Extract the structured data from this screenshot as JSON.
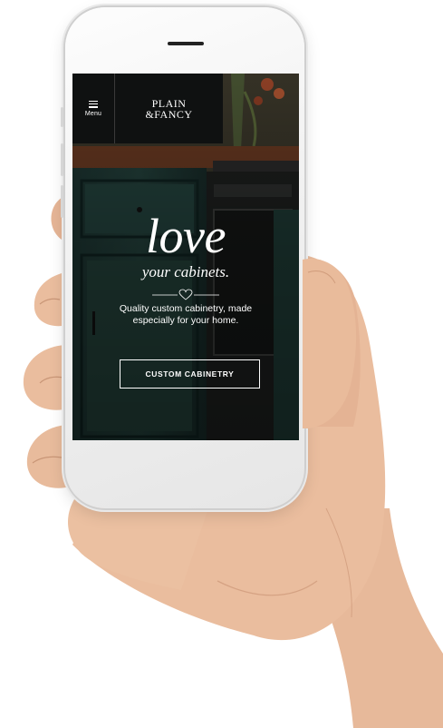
{
  "header": {
    "menu_label": "Menu",
    "logo_line1": "PLAIN",
    "logo_line2": "&FANCY"
  },
  "hero": {
    "title": "love",
    "subtitle": "your cabinets.",
    "description": "Quality custom cabinetry, made especially for your home.",
    "cta_label": "CUSTOM CABINETRY"
  },
  "colors": {
    "header_bg": "#0f1111",
    "cabinet_green": "#1f3a36",
    "text": "#ffffff"
  },
  "icons": [
    "menu-icon",
    "heart-icon"
  ]
}
